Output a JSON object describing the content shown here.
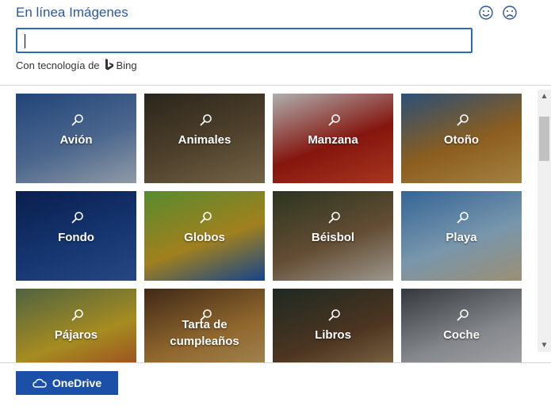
{
  "header": {
    "title": "En línea Imágenes",
    "feedback": [
      {
        "icon": "smile-icon"
      },
      {
        "icon": "frown-icon"
      }
    ]
  },
  "search": {
    "value": "",
    "placeholder": ""
  },
  "powered_by": {
    "text": "Con tecnología de",
    "brand": "Bing"
  },
  "categories": [
    {
      "label": "Avión",
      "colors": [
        "#2d5fa8",
        "#6a8fc4",
        "#c8d6e8"
      ]
    },
    {
      "label": "Animales",
      "colors": [
        "#3a3527",
        "#6f5b3e",
        "#a08a63"
      ]
    },
    {
      "label": "Manzana",
      "colors": [
        "#f3f3f3",
        "#b81e14",
        "#e84c2b"
      ]
    },
    {
      "label": "Otoño",
      "colors": [
        "#3c6fa5",
        "#c3822c",
        "#e3b45a"
      ]
    },
    {
      "label": "Fondo",
      "colors": [
        "#0e2b6b",
        "#1e4a9c",
        "#3564b3"
      ]
    },
    {
      "label": "Globos",
      "colors": [
        "#7ac143",
        "#e0b22a",
        "#1f5fc2"
      ]
    },
    {
      "label": "Béisbol",
      "colors": [
        "#3e4a2e",
        "#8a6b48",
        "#d9d1c4"
      ]
    },
    {
      "label": "Playa",
      "colors": [
        "#4a8cd0",
        "#a7d0ef",
        "#d8c6a1"
      ]
    },
    {
      "label": "Pájaros",
      "colors": [
        "#6e8a5a",
        "#e6c22e",
        "#d95a2b"
      ]
    },
    {
      "label": "Tarta de cumpleaños",
      "label_lines": [
        "Tarta de",
        "cumpleaños"
      ],
      "colors": [
        "#5a3a22",
        "#c9903f",
        "#e2c07c"
      ]
    },
    {
      "label": "Libros",
      "colors": [
        "#2b3a31",
        "#6b4a2e",
        "#b89a6a"
      ]
    },
    {
      "label": "Coche",
      "colors": [
        "#4a4e55",
        "#b8bcc2",
        "#e8e9eb"
      ]
    }
  ],
  "footer": {
    "onedrive_label": "OneDrive"
  },
  "theme": {
    "accent": "#2b579a",
    "button": "#1b4fa8",
    "input_border": "#2b6cb7"
  }
}
